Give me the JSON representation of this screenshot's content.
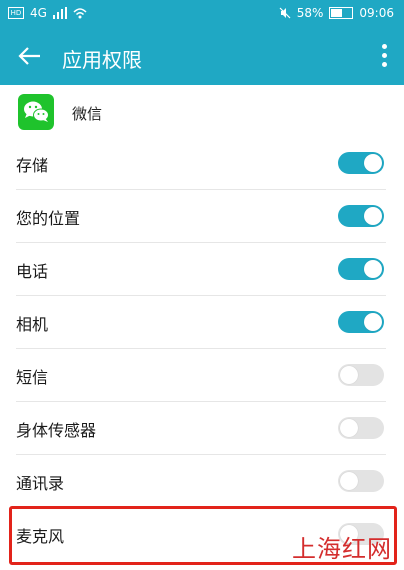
{
  "status_bar": {
    "sim_label": "HD",
    "network": "4G",
    "battery": "58%",
    "battery_level": 0.58,
    "time": "09:06"
  },
  "app_bar": {
    "title": "应用权限"
  },
  "app": {
    "name": "微信"
  },
  "permissions": [
    {
      "label": "存储",
      "enabled": true
    },
    {
      "label": "您的位置",
      "enabled": true
    },
    {
      "label": "电话",
      "enabled": true
    },
    {
      "label": "相机",
      "enabled": true
    },
    {
      "label": "短信",
      "enabled": false
    },
    {
      "label": "身体传感器",
      "enabled": false
    },
    {
      "label": "通讯录",
      "enabled": false
    },
    {
      "label": "麦克风",
      "enabled": false
    }
  ],
  "watermark": "上海红网",
  "colors": {
    "accent": "#1fa8c4",
    "wechat_green": "#1fc32c",
    "highlight_red": "#e2231a"
  }
}
